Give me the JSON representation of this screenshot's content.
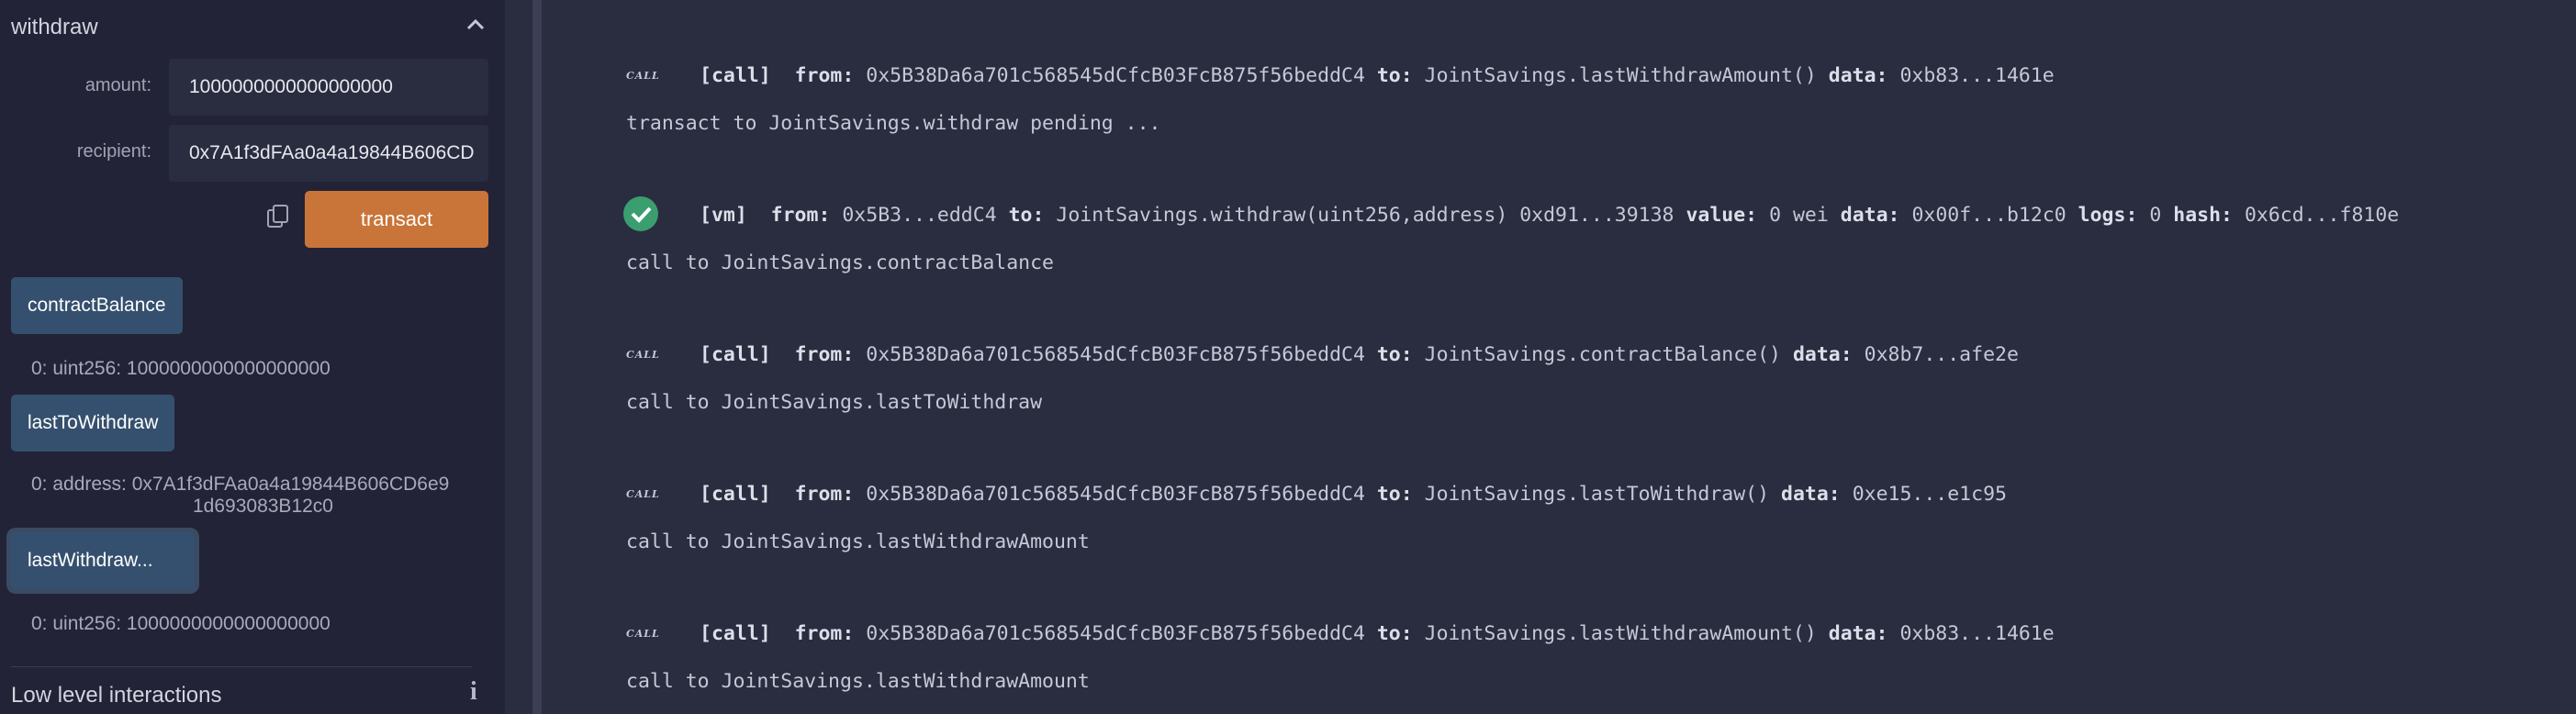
{
  "sidebar": {
    "section_title": "withdraw",
    "amount_label": "amount:",
    "amount_value": "1000000000000000000",
    "recipient_label": "recipient:",
    "recipient_value": "0x7A1f3dFAa0a4a19844B606CD",
    "transact_label": "transact",
    "functions": [
      {
        "label": "contractBalance",
        "result": "0: uint256: 1000000000000000000"
      },
      {
        "label": "lastToWithdraw",
        "result_line1": "0: address: 0x7A1f3dFAa0a4a19844B606CD6e9",
        "result_line2": "1d693083B12c0"
      },
      {
        "label": "lastWithdraw...",
        "result": "0: uint256: 1000000000000000000"
      }
    ],
    "low_level": "Low level interactions"
  },
  "terminal": {
    "entries": [
      {
        "tag": "CALL",
        "kind": "[call]",
        "from": "0x5B38Da6a701c568545dCfcB03FcB875f56beddC4",
        "to": "JointSavings.lastWithdrawAmount()",
        "data": "0xb83...1461e",
        "msg": "transact to JointSavings.withdraw pending ..."
      },
      {
        "kind": "[vm]",
        "from": "0x5B3...eddC4",
        "to": "JointSavings.withdraw(uint256,address) 0xd91...39138",
        "value": "0 wei",
        "data": "0x00f...b12c0",
        "logs": "0",
        "hash": "0x6cd...f810e",
        "msg": "call to JointSavings.contractBalance"
      },
      {
        "tag": "CALL",
        "kind": "[call]",
        "from": "0x5B38Da6a701c568545dCfcB03FcB875f56beddC4",
        "to": "JointSavings.contractBalance()",
        "data": "0x8b7...afe2e",
        "msg": "call to JointSavings.lastToWithdraw"
      },
      {
        "tag": "CALL",
        "kind": "[call]",
        "from": "0x5B38Da6a701c568545dCfcB03FcB875f56beddC4",
        "to": "JointSavings.lastToWithdraw()",
        "data": "0xe15...e1c95",
        "msg": "call to JointSavings.lastWithdrawAmount"
      },
      {
        "tag": "CALL",
        "kind": "[call]",
        "from": "0x5B38Da6a701c568545dCfcB03FcB875f56beddC4",
        "to": "JointSavings.lastWithdrawAmount()",
        "data": "0xb83...1461e",
        "msg": "call to JointSavings.lastWithdrawAmount"
      }
    ],
    "labels": {
      "from": "from:",
      "to": "to:",
      "data": "data:",
      "value": "value:",
      "logs": "logs:",
      "hash": "hash:"
    }
  },
  "colors": {
    "accent": "#c97539",
    "button": "#35506e",
    "success": "#3a9e6f"
  }
}
